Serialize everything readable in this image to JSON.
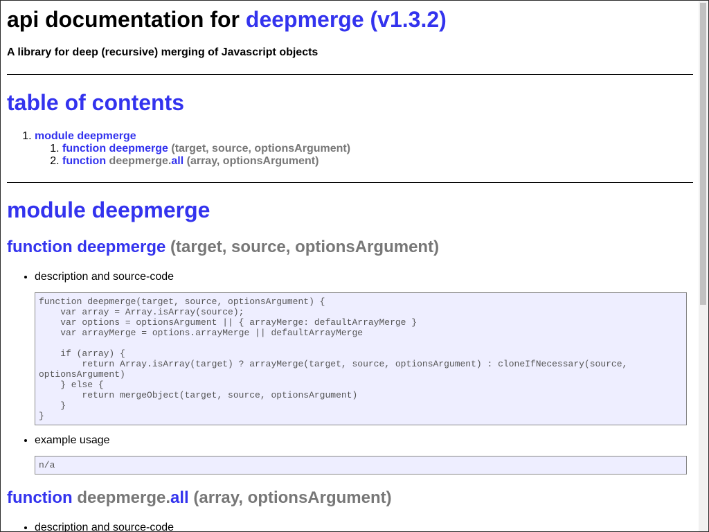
{
  "header": {
    "title_prefix": "api documentation for ",
    "title_link": "deepmerge (v1.3.2)",
    "subtitle": "A library for deep (recursive) merging of Javascript objects"
  },
  "toc": {
    "heading": "table of contents",
    "modules": [
      {
        "label": "module deepmerge",
        "functions": [
          {
            "keyword": "function",
            "name": "deepmerge",
            "params": "(target, source, optionsArgument)"
          },
          {
            "keyword": "function",
            "name_prefix": "deepmerge.",
            "name": "all",
            "params": "(array, optionsArgument)"
          }
        ]
      }
    ]
  },
  "module": {
    "heading": "module deepmerge",
    "functions": [
      {
        "keyword": "function",
        "name": "deepmerge",
        "params": "(target, source, optionsArgument)",
        "description_label": "description and source-code",
        "source_code": "function deepmerge(target, source, optionsArgument) {\n    var array = Array.isArray(source);\n    var options = optionsArgument || { arrayMerge: defaultArrayMerge }\n    var arrayMerge = options.arrayMerge || defaultArrayMerge\n\n    if (array) {\n        return Array.isArray(target) ? arrayMerge(target, source, optionsArgument) : cloneIfNecessary(source,\noptionsArgument)\n    } else {\n        return mergeObject(target, source, optionsArgument)\n    }\n}",
        "example_label": "example usage",
        "example_code": "n/a"
      },
      {
        "keyword": "function",
        "name_prefix": "deepmerge.",
        "name": "all",
        "params": "(array, optionsArgument)",
        "description_label": "description and source-code"
      }
    ]
  }
}
